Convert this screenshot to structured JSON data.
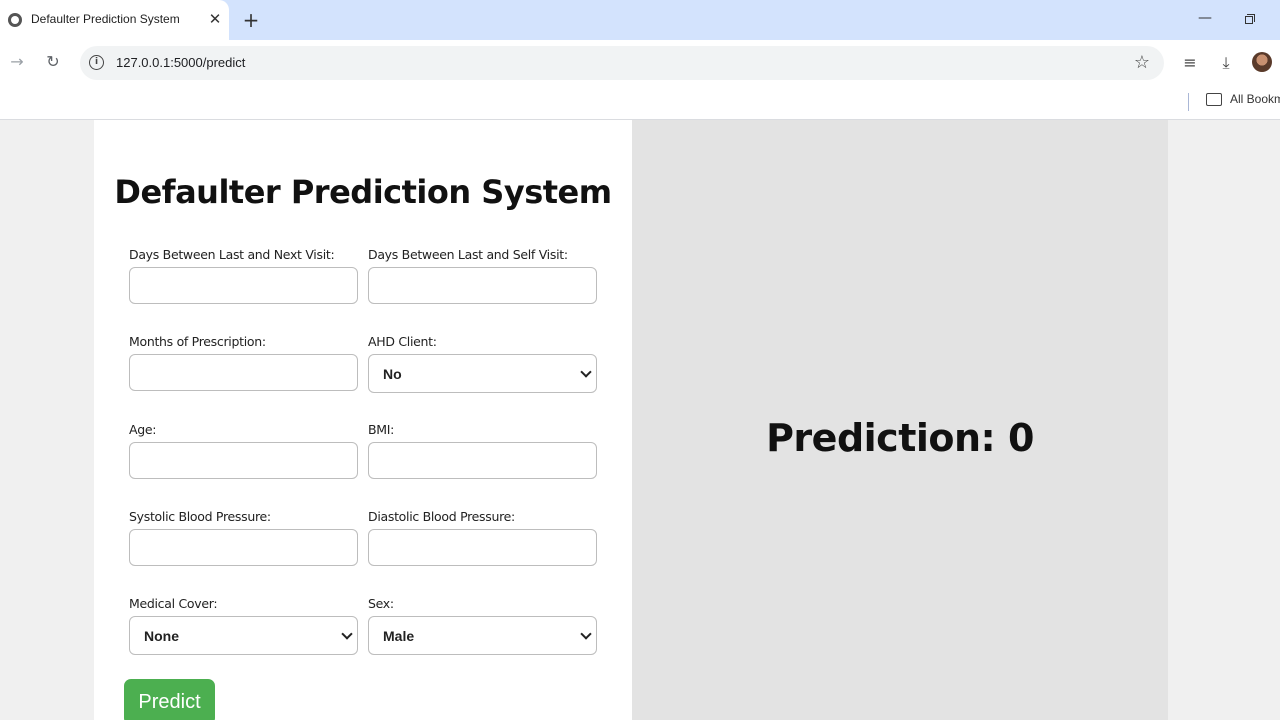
{
  "browser": {
    "tab_title": "Defaulter Prediction System",
    "tab_close": "✕",
    "new_tab": "+",
    "url": "127.0.0.1:5000/predict",
    "bookmarks_label": "All Bookm"
  },
  "form": {
    "title": "Defaulter Prediction System",
    "fields": [
      {
        "label": "Days Between Last and Next Visit:",
        "type": "input",
        "value": ""
      },
      {
        "label": "Days Between Last and Self Visit:",
        "type": "input",
        "value": ""
      },
      {
        "label": "Months of Prescription:",
        "type": "input",
        "value": ""
      },
      {
        "label": "AHD Client:",
        "type": "select",
        "value": "No"
      },
      {
        "label": "Age:",
        "type": "input",
        "value": ""
      },
      {
        "label": "BMI:",
        "type": "input",
        "value": ""
      },
      {
        "label": "Systolic Blood Pressure:",
        "type": "input",
        "value": ""
      },
      {
        "label": "Diastolic Blood Pressure:",
        "type": "input",
        "value": ""
      },
      {
        "label": "Medical Cover:",
        "type": "select",
        "value": "None"
      },
      {
        "label": "Sex:",
        "type": "select",
        "value": "Male"
      }
    ],
    "submit_label": "Predict"
  },
  "result": {
    "text": "Prediction: 0"
  },
  "colors": {
    "predict_button": "#4caf50",
    "result_panel": "#e3e3e3",
    "tab_strip": "#d3e3fd"
  }
}
